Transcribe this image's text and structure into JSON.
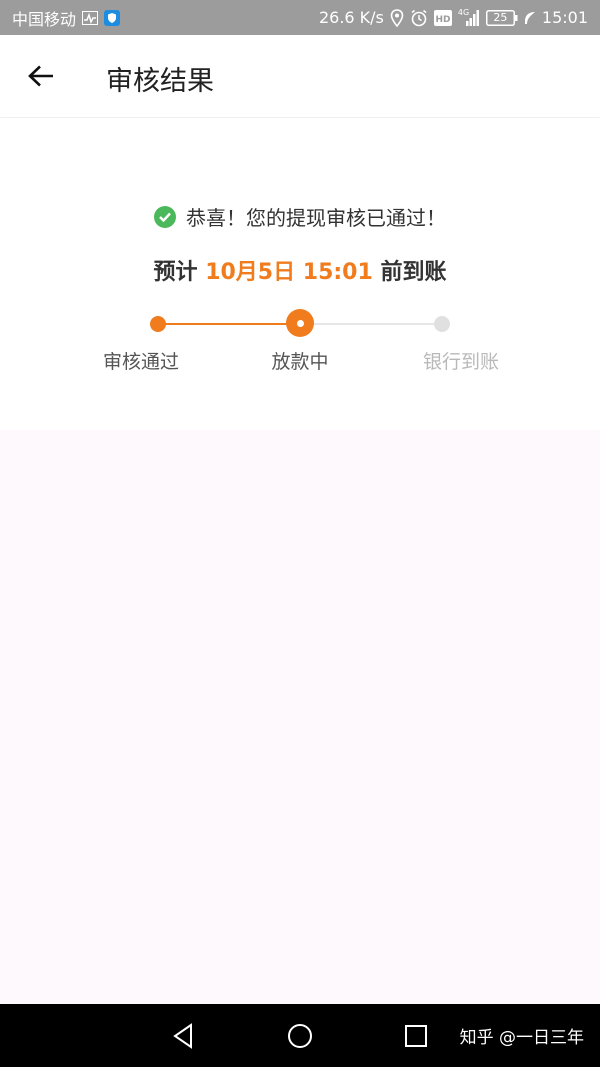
{
  "status_bar": {
    "carrier": "中国移动",
    "net_speed": "26.6 K/s",
    "network_label": "4G",
    "battery_level": "25",
    "time": "15:01",
    "icons": [
      "activity-icon",
      "shield-app-icon",
      "location-icon",
      "alarm-icon",
      "hd-icon",
      "signal-icon",
      "battery-icon",
      "leaf-icon"
    ]
  },
  "app_bar": {
    "title": "审核结果",
    "back_icon": "arrow-left-icon"
  },
  "result": {
    "success_message": "恭喜！您的提现审核已通过！",
    "eta_prefix": "预计",
    "eta_time": "10月5日 15:01",
    "eta_suffix": "前到账",
    "accent_color": "#f07c1e",
    "success_color": "#4cb85c"
  },
  "progress": {
    "steps": [
      {
        "label": "审核通过",
        "state": "done"
      },
      {
        "label": "放款中",
        "state": "current"
      },
      {
        "label": "银行到账",
        "state": "pending"
      }
    ]
  },
  "nav_bar": {
    "buttons": [
      "triangle-back-icon",
      "circle-home-icon",
      "square-recent-icon"
    ],
    "watermark": "知乎 @一日三年"
  }
}
